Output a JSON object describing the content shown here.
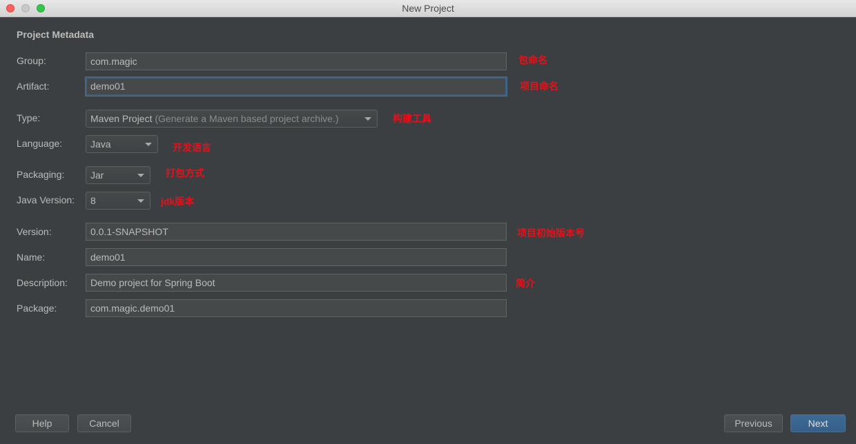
{
  "window": {
    "title": "New Project"
  },
  "section_title": "Project Metadata",
  "fields": {
    "group": {
      "label": "Group:",
      "value": "com.magic",
      "annotation": "包命名"
    },
    "artifact": {
      "label": "Artifact:",
      "value": "demo01",
      "annotation": "项目命名"
    },
    "type": {
      "label": "Type:",
      "value": "Maven Project",
      "hint": "(Generate a Maven based project archive.)",
      "annotation": "构建工具"
    },
    "language": {
      "label": "Language:",
      "value": "Java",
      "annotation": "开发语言"
    },
    "packaging": {
      "label": "Packaging:",
      "value": "Jar",
      "annotation": "打包方式"
    },
    "java_version": {
      "label": "Java Version:",
      "value": "8",
      "annotation": "jdk版本"
    },
    "version": {
      "label": "Version:",
      "value": "0.0.1-SNAPSHOT",
      "annotation": "项目初始版本号"
    },
    "name": {
      "label": "Name:",
      "value": "demo01"
    },
    "description": {
      "label": "Description:",
      "value": "Demo project for Spring Boot",
      "annotation": "简介"
    },
    "package": {
      "label": "Package:",
      "value": "com.magic.demo01"
    }
  },
  "buttons": {
    "help": "Help",
    "cancel": "Cancel",
    "previous": "Previous",
    "next": "Next"
  },
  "colors": {
    "background": "#3c3f41",
    "annotation": "#e8101a",
    "primary_button": "#365f88",
    "focus_border": "#3d6185"
  }
}
